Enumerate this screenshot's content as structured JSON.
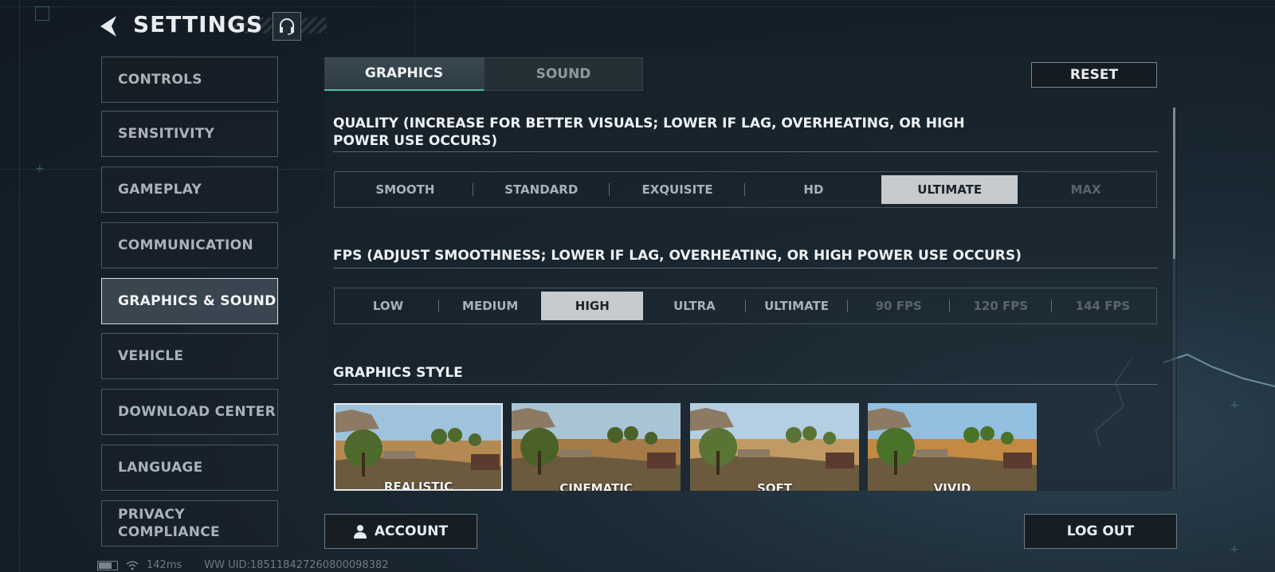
{
  "header": {
    "title": "SETTINGS",
    "back_icon": "back-arrow-icon",
    "support_icon": "headset-icon"
  },
  "sidebar": {
    "items": [
      {
        "label": "CONTROLS",
        "active": false
      },
      {
        "label": "SENSITIVITY",
        "active": false
      },
      {
        "label": "GAMEPLAY",
        "active": false
      },
      {
        "label": "COMMUNICATION",
        "active": false
      },
      {
        "label": "GRAPHICS & SOUND",
        "active": true
      },
      {
        "label": "VEHICLE",
        "active": false
      },
      {
        "label": "DOWNLOAD CENTER",
        "active": false
      },
      {
        "label": "LANGUAGE",
        "active": false
      },
      {
        "label": "PRIVACY COMPLIANCE",
        "active": false
      }
    ]
  },
  "tabs": [
    {
      "label": "GRAPHICS",
      "active": true
    },
    {
      "label": "SOUND",
      "active": false
    }
  ],
  "reset_label": "RESET",
  "quality": {
    "title": "QUALITY (INCREASE FOR BETTER VISUALS; LOWER IF LAG, OVERHEATING, OR HIGH POWER USE OCCURS)",
    "options": [
      "SMOOTH",
      "STANDARD",
      "EXQUISITE",
      "HD",
      "ULTIMATE",
      "MAX"
    ],
    "selected": "ULTIMATE",
    "disabled": [
      "MAX"
    ]
  },
  "fps": {
    "title": "FPS (ADJUST SMOOTHNESS; LOWER IF LAG, OVERHEATING, OR HIGH POWER USE OCCURS)",
    "options": [
      "LOW",
      "MEDIUM",
      "HIGH",
      "ULTRA",
      "ULTIMATE",
      "90 FPS",
      "120 FPS",
      "144 FPS"
    ],
    "selected": "HIGH",
    "disabled": [
      "90 FPS",
      "120 FPS",
      "144 FPS"
    ]
  },
  "graphics_style": {
    "title": "GRAPHICS STYLE",
    "options": [
      "REALISTIC",
      "CINEMATIC",
      "SOFT",
      "VIVID"
    ],
    "selected": "REALISTIC"
  },
  "footer": {
    "account_label": "ACCOUNT",
    "account_icon": "user-icon",
    "logout_label": "LOG OUT"
  },
  "status": {
    "ping": "142ms",
    "uid": "WW UID:1851184272608000​98382",
    "battery_icon": "battery-icon",
    "wifi_icon": "wifi-icon"
  },
  "colors": {
    "accent": "#49c4a0",
    "selected_bg": "#c7cbce",
    "background": "#141f28"
  }
}
